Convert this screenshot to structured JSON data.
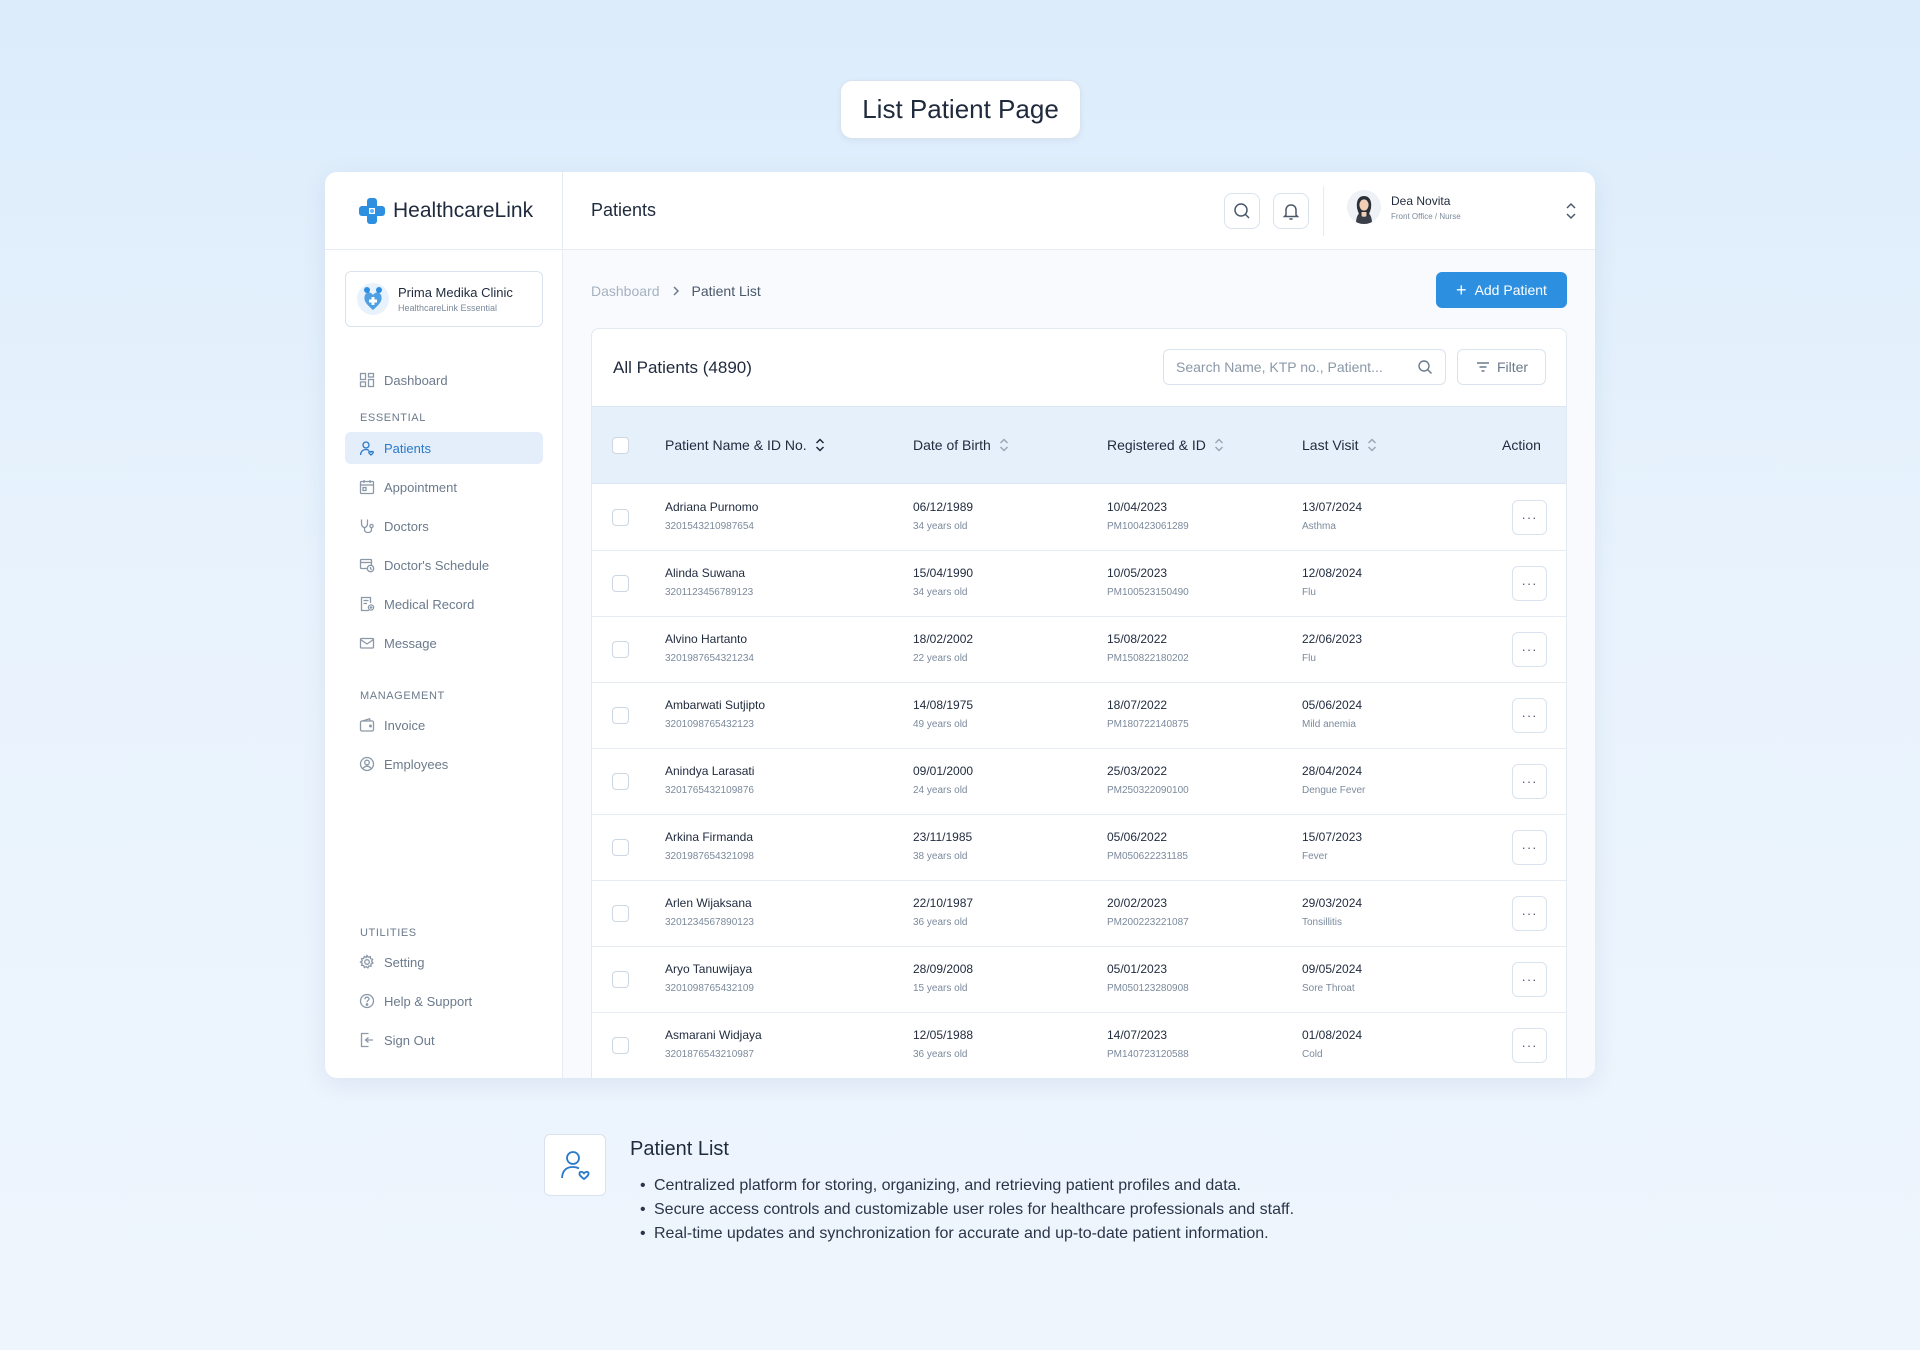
{
  "page_title": "List Patient Page",
  "brand": {
    "name": "HealthcareLink"
  },
  "clinic": {
    "name": "Prima Medika Clinic",
    "plan": "HealthcareLink Essential"
  },
  "sidebar": {
    "dashboard": "Dashboard",
    "sections": {
      "essential": "ESSENTIAL",
      "management": "MANAGEMENT",
      "utilities": "UTILITIES"
    },
    "essential": [
      "Patients",
      "Appointment",
      "Doctors",
      "Doctor's Schedule",
      "Medical Record",
      "Message"
    ],
    "management": [
      "Invoice",
      "Employees"
    ],
    "utilities": [
      "Setting",
      "Help & Support",
      "Sign Out"
    ],
    "active_item": "Patients"
  },
  "header": {
    "title": "Patients"
  },
  "user": {
    "name": "Dea Novita",
    "role": "Front Office / Nurse"
  },
  "breadcrumb": {
    "parent": "Dashboard",
    "current": "Patient List"
  },
  "add_button": {
    "label": "Add Patient"
  },
  "table_card": {
    "title": "All Patients (4890)",
    "search_placeholder": "Search Name, KTP no., Patient...",
    "filter_label": "Filter"
  },
  "columns": {
    "name": "Patient Name & ID No.",
    "dob": "Date of Birth",
    "registered": "Registered & ID",
    "last_visit": "Last Visit",
    "action": "Action"
  },
  "rows": [
    {
      "name": "Adriana Purnomo",
      "id": "3201543210987654",
      "dob": "06/12/1989",
      "age": "34 years old",
      "reg_date": "10/04/2023",
      "reg_id": "PM100423061289",
      "visit": "13/07/2024",
      "diagnosis": "Asthma"
    },
    {
      "name": "Alinda Suwana",
      "id": "3201123456789123",
      "dob": "15/04/1990",
      "age": "34 years old",
      "reg_date": "10/05/2023",
      "reg_id": "PM100523150490",
      "visit": "12/08/2024",
      "diagnosis": "Flu"
    },
    {
      "name": "Alvino Hartanto",
      "id": "3201987654321234",
      "dob": "18/02/2002",
      "age": "22 years old",
      "reg_date": "15/08/2022",
      "reg_id": "PM150822180202",
      "visit": "22/06/2023",
      "diagnosis": "Flu"
    },
    {
      "name": "Ambarwati Sutjipto",
      "id": "3201098765432123",
      "dob": "14/08/1975",
      "age": "49 years old",
      "reg_date": "18/07/2022",
      "reg_id": "PM180722140875",
      "visit": "05/06/2024",
      "diagnosis": "Mild anemia"
    },
    {
      "name": "Anindya Larasati",
      "id": "3201765432109876",
      "dob": "09/01/2000",
      "age": "24 years old",
      "reg_date": "25/03/2022",
      "reg_id": "PM250322090100",
      "visit": "28/04/2024",
      "diagnosis": "Dengue Fever"
    },
    {
      "name": "Arkina Firmanda",
      "id": "3201987654321098",
      "dob": "23/11/1985",
      "age": "38 years old",
      "reg_date": "05/06/2022",
      "reg_id": "PM050622231185",
      "visit": "15/07/2023",
      "diagnosis": "Fever"
    },
    {
      "name": "Arlen Wijaksana",
      "id": "3201234567890123",
      "dob": "22/10/1987",
      "age": "36  years old",
      "reg_date": "20/02/2023",
      "reg_id": "PM200223221087",
      "visit": "29/03/2024",
      "diagnosis": "Tonsillitis"
    },
    {
      "name": "Aryo Tanuwijaya",
      "id": "3201098765432109",
      "dob": "28/09/2008",
      "age": "15 years old",
      "reg_date": "05/01/2023",
      "reg_id": "PM050123280908",
      "visit": "09/05/2024",
      "diagnosis": "Sore Throat"
    },
    {
      "name": "Asmarani Widjaya",
      "id": "3201876543210987",
      "dob": "12/05/1988",
      "age": "36 years old",
      "reg_date": "14/07/2023",
      "reg_id": "PM140723120588",
      "visit": "01/08/2024",
      "diagnosis": "Cold"
    }
  ],
  "more_label": "···",
  "feature": {
    "title": "Patient List",
    "bullets": [
      "Centralized platform for storing, organizing, and retrieving patient profiles and data.",
      "Secure access controls and customizable user roles for healthcare professionals and staff.",
      "Real-time updates and synchronization for accurate and up-to-date patient information."
    ]
  },
  "colors": {
    "accent": "#2d8fe0",
    "active_bg": "#e3eefa",
    "header_bg": "#e6f0fb"
  }
}
